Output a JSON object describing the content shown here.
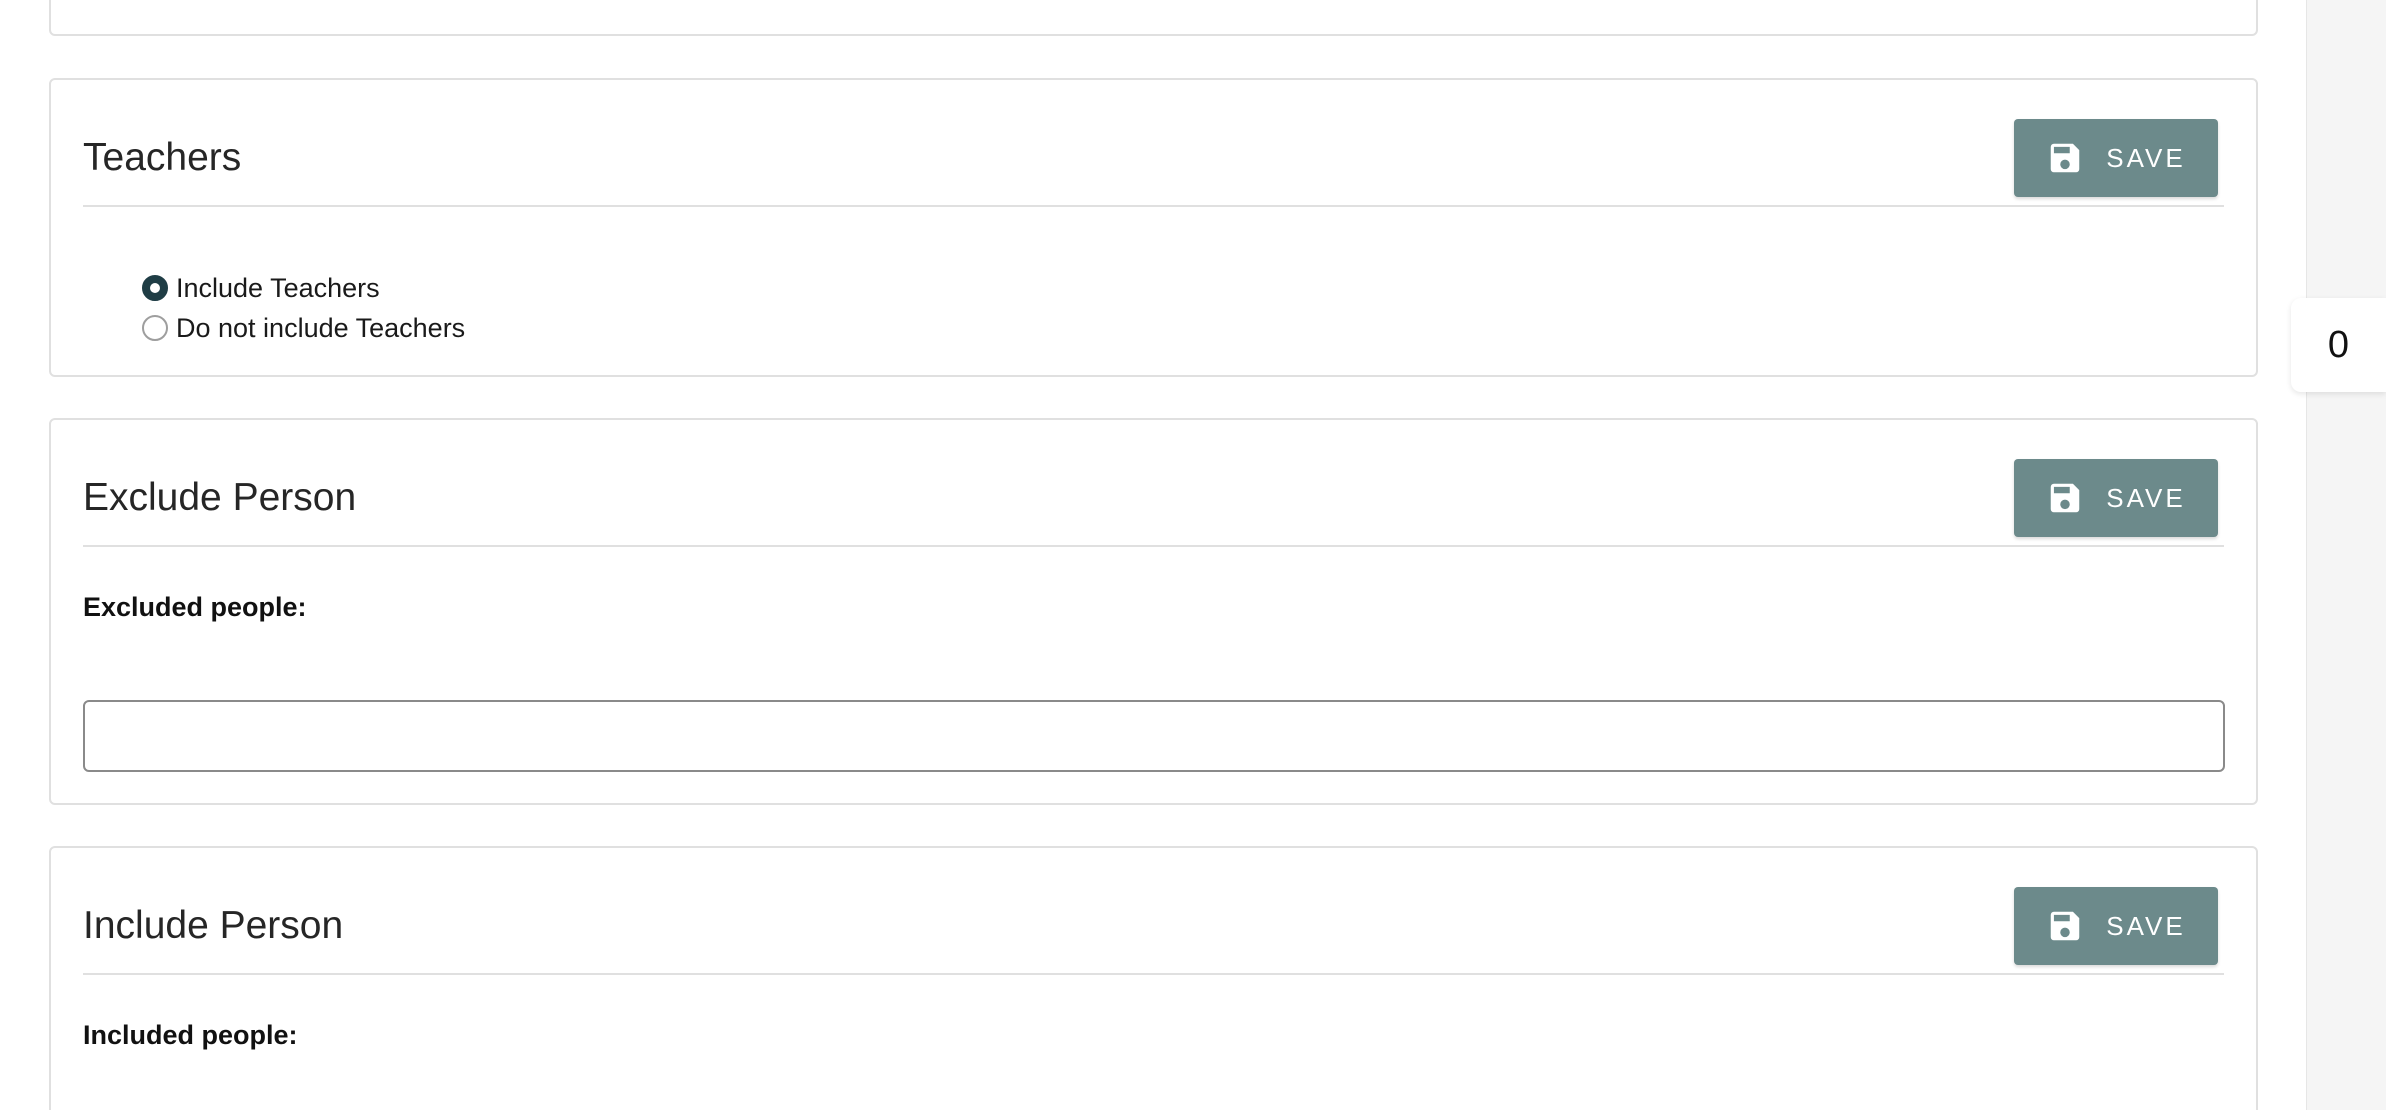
{
  "teachers": {
    "title": "Teachers",
    "save_label": "SAVE",
    "options": [
      {
        "label": "Include Teachers",
        "checked": true
      },
      {
        "label": "Do not include Teachers",
        "checked": false
      }
    ]
  },
  "exclude_person": {
    "title": "Exclude Person",
    "save_label": "SAVE",
    "field_label": "Excluded people:",
    "input_value": ""
  },
  "include_person": {
    "title": "Include Person",
    "save_label": "SAVE",
    "field_label": "Included people:"
  },
  "side_counter": {
    "value": "0"
  },
  "colors": {
    "save_button": "#6c8a8b",
    "radio_checked": "#1f3d45",
    "card_border": "#e0e0e0"
  },
  "icons": {
    "save": "floppy-disk-icon"
  }
}
